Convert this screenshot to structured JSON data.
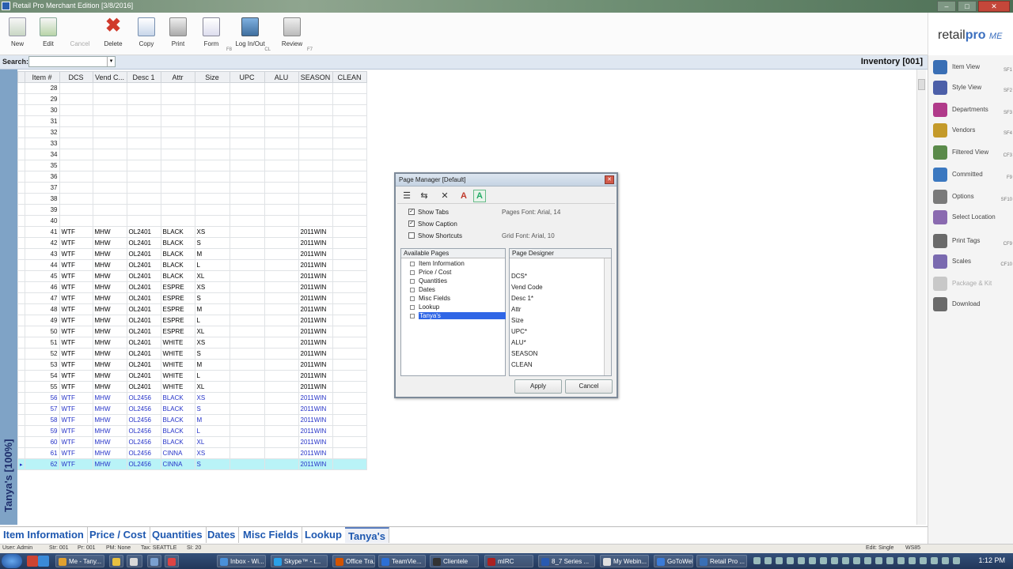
{
  "window": {
    "title": "Retail Pro Merchant Edition [3/8/2016]",
    "buttons": [
      "–",
      "□",
      "✕"
    ]
  },
  "toolbar": [
    {
      "label": "New",
      "icon": "new-doc-icon",
      "hotkey": ""
    },
    {
      "label": "Edit",
      "icon": "edit-icon",
      "hotkey": ""
    },
    {
      "label": "Cancel",
      "icon": "cancel-icon",
      "hotkey": "",
      "disabled": true
    },
    {
      "label": "Delete",
      "icon": "delete-icon",
      "hotkey": ""
    },
    {
      "label": "Copy",
      "icon": "copy-icon",
      "hotkey": ""
    },
    {
      "label": "Print",
      "icon": "print-icon",
      "hotkey": ""
    },
    {
      "label": "Form",
      "icon": "form-icon",
      "hotkey": "F8"
    },
    {
      "label": "Log In/Out",
      "icon": "login-icon",
      "hotkey": "CL"
    },
    {
      "label": "Review",
      "icon": "review-icon",
      "hotkey": "F7"
    }
  ],
  "logo": {
    "main": "retail",
    "pro": "pro",
    "me": "ME"
  },
  "search": {
    "label": "Search:",
    "value": ""
  },
  "module_title": "Inventory [001]",
  "left_label": "Tanya's [100%]",
  "grid": {
    "columns": [
      "Item #",
      "DCS",
      "Vend C...",
      "Desc 1",
      "Attr",
      "Size",
      "UPC",
      "ALU",
      "SEASON",
      "CLEAN"
    ],
    "rows": [
      {
        "n": "28",
        "cells": [
          "",
          "",
          "",
          "",
          "",
          "",
          "",
          "",
          ""
        ]
      },
      {
        "n": "29",
        "cells": [
          "",
          "",
          "",
          "",
          "",
          "",
          "",
          "",
          ""
        ]
      },
      {
        "n": "30",
        "cells": [
          "",
          "",
          "",
          "",
          "",
          "",
          "",
          "",
          ""
        ]
      },
      {
        "n": "31",
        "cells": [
          "",
          "",
          "",
          "",
          "",
          "",
          "",
          "",
          ""
        ]
      },
      {
        "n": "32",
        "cells": [
          "",
          "",
          "",
          "",
          "",
          "",
          "",
          "",
          ""
        ]
      },
      {
        "n": "33",
        "cells": [
          "",
          "",
          "",
          "",
          "",
          "",
          "",
          "",
          ""
        ]
      },
      {
        "n": "34",
        "cells": [
          "",
          "",
          "",
          "",
          "",
          "",
          "",
          "",
          ""
        ]
      },
      {
        "n": "35",
        "cells": [
          "",
          "",
          "",
          "",
          "",
          "",
          "",
          "",
          ""
        ]
      },
      {
        "n": "36",
        "cells": [
          "",
          "",
          "",
          "",
          "",
          "",
          "",
          "",
          ""
        ]
      },
      {
        "n": "37",
        "cells": [
          "",
          "",
          "",
          "",
          "",
          "",
          "",
          "",
          ""
        ]
      },
      {
        "n": "38",
        "cells": [
          "",
          "",
          "",
          "",
          "",
          "",
          "",
          "",
          ""
        ]
      },
      {
        "n": "39",
        "cells": [
          "",
          "",
          "",
          "",
          "",
          "",
          "",
          "",
          ""
        ]
      },
      {
        "n": "40",
        "cells": [
          "",
          "",
          "",
          "",
          "",
          "",
          "",
          "",
          ""
        ]
      },
      {
        "n": "41",
        "cells": [
          "WTF",
          "MHW",
          "OL2401",
          "BLACK",
          "XS",
          "",
          "",
          "2011WIN",
          ""
        ]
      },
      {
        "n": "42",
        "cells": [
          "WTF",
          "MHW",
          "OL2401",
          "BLACK",
          "S",
          "",
          "",
          "2011WIN",
          ""
        ]
      },
      {
        "n": "43",
        "cells": [
          "WTF",
          "MHW",
          "OL2401",
          "BLACK",
          "M",
          "",
          "",
          "2011WIN",
          ""
        ]
      },
      {
        "n": "44",
        "cells": [
          "WTF",
          "MHW",
          "OL2401",
          "BLACK",
          "L",
          "",
          "",
          "2011WIN",
          ""
        ]
      },
      {
        "n": "45",
        "cells": [
          "WTF",
          "MHW",
          "OL2401",
          "BLACK",
          "XL",
          "",
          "",
          "2011WIN",
          ""
        ]
      },
      {
        "n": "46",
        "cells": [
          "WTF",
          "MHW",
          "OL2401",
          "ESPRE",
          "XS",
          "",
          "",
          "2011WIN",
          ""
        ]
      },
      {
        "n": "47",
        "cells": [
          "WTF",
          "MHW",
          "OL2401",
          "ESPRE",
          "S",
          "",
          "",
          "2011WIN",
          ""
        ]
      },
      {
        "n": "48",
        "cells": [
          "WTF",
          "MHW",
          "OL2401",
          "ESPRE",
          "M",
          "",
          "",
          "2011WIN",
          ""
        ]
      },
      {
        "n": "49",
        "cells": [
          "WTF",
          "MHW",
          "OL2401",
          "ESPRE",
          "L",
          "",
          "",
          "2011WIN",
          ""
        ]
      },
      {
        "n": "50",
        "cells": [
          "WTF",
          "MHW",
          "OL2401",
          "ESPRE",
          "XL",
          "",
          "",
          "2011WIN",
          ""
        ]
      },
      {
        "n": "51",
        "cells": [
          "WTF",
          "MHW",
          "OL2401",
          "WHITE",
          "XS",
          "",
          "",
          "2011WIN",
          ""
        ]
      },
      {
        "n": "52",
        "cells": [
          "WTF",
          "MHW",
          "OL2401",
          "WHITE",
          "S",
          "",
          "",
          "2011WIN",
          ""
        ]
      },
      {
        "n": "53",
        "cells": [
          "WTF",
          "MHW",
          "OL2401",
          "WHITE",
          "M",
          "",
          "",
          "2011WIN",
          ""
        ]
      },
      {
        "n": "54",
        "cells": [
          "WTF",
          "MHW",
          "OL2401",
          "WHITE",
          "L",
          "",
          "",
          "2011WIN",
          ""
        ]
      },
      {
        "n": "55",
        "cells": [
          "WTF",
          "MHW",
          "OL2401",
          "WHITE",
          "XL",
          "",
          "",
          "2011WIN",
          ""
        ]
      },
      {
        "n": "56",
        "cells": [
          "WTF",
          "MHW",
          "OL2456",
          "BLACK",
          "XS",
          "",
          "",
          "2011WIN",
          ""
        ],
        "blue": true
      },
      {
        "n": "57",
        "cells": [
          "WTF",
          "MHW",
          "OL2456",
          "BLACK",
          "S",
          "",
          "",
          "2011WIN",
          ""
        ],
        "blue": true
      },
      {
        "n": "58",
        "cells": [
          "WTF",
          "MHW",
          "OL2456",
          "BLACK",
          "M",
          "",
          "",
          "2011WIN",
          ""
        ],
        "blue": true
      },
      {
        "n": "59",
        "cells": [
          "WTF",
          "MHW",
          "OL2456",
          "BLACK",
          "L",
          "",
          "",
          "2011WIN",
          ""
        ],
        "blue": true
      },
      {
        "n": "60",
        "cells": [
          "WTF",
          "MHW",
          "OL2456",
          "BLACK",
          "XL",
          "",
          "",
          "2011WIN",
          ""
        ],
        "blue": true
      },
      {
        "n": "61",
        "cells": [
          "WTF",
          "MHW",
          "OL2456",
          "CINNA",
          "XS",
          "",
          "",
          "2011WIN",
          ""
        ],
        "blue": true
      },
      {
        "n": "62",
        "cells": [
          "WTF",
          "MHW",
          "OL2456",
          "CINNA",
          "S",
          "",
          "",
          "2011WIN",
          ""
        ],
        "blue": true,
        "current": true
      }
    ]
  },
  "side_panel": [
    {
      "label": "Item View",
      "shortcut": "SF1",
      "icon": "item-view-icon",
      "color": "#3a6fb5"
    },
    {
      "label": "Style View",
      "shortcut": "SF2",
      "icon": "style-view-icon",
      "color": "#4c5fa8"
    },
    {
      "label": "Departments",
      "shortcut": "SF3",
      "icon": "departments-icon",
      "color": "#b03a8a"
    },
    {
      "label": "Vendors",
      "shortcut": "SF4",
      "icon": "vendors-icon",
      "color": "#c49a2a"
    },
    {
      "label": "Filtered View",
      "shortcut": "CF3",
      "icon": "filter-icon",
      "color": "#5a8a4a"
    },
    {
      "label": "Committed",
      "shortcut": "F9",
      "icon": "committed-icon",
      "color": "#3b78c0"
    },
    {
      "label": "Options",
      "shortcut": "SF10",
      "icon": "options-icon",
      "color": "#7a7a7a"
    },
    {
      "label": "Select Location",
      "shortcut": "",
      "icon": "location-icon",
      "color": "#8a6ab0"
    },
    {
      "label": "Print Tags",
      "shortcut": "CF9",
      "icon": "print-tags-icon",
      "color": "#6a6a6a"
    },
    {
      "label": "Scales",
      "shortcut": "CF10",
      "icon": "scales-icon",
      "color": "#7a6ab0"
    },
    {
      "label": "Package & Kit",
      "shortcut": "",
      "icon": "package-icon",
      "color": "#c8c8c8",
      "disabled": true
    },
    {
      "label": "Download",
      "shortcut": "",
      "icon": "download-icon",
      "color": "#6a6a6a"
    }
  ],
  "tabs": [
    "Item Information",
    "Price / Cost",
    "Quantities",
    "Dates",
    "Misc Fields",
    "Lookup",
    "Tanya's"
  ],
  "active_tab": "Tanya's",
  "status": {
    "user": "User: Admin",
    "store": "Str: 001",
    "printer": "Pr: 001",
    "pm": "PM: None",
    "tax": "Tax: SEATTLE",
    "si": "SI: 20",
    "mode": "Edit: Single",
    "ws": "WS85"
  },
  "dialog": {
    "title": "Page Manager [Default]",
    "close": "✕",
    "options": [
      {
        "label": "Show Tabs",
        "checked": true
      },
      {
        "label": "Show Caption",
        "checked": true
      },
      {
        "label": "Show Shortcuts",
        "checked": false
      }
    ],
    "pages_font": "Pages Font: Arial, 14",
    "grid_font": "Grid Font: Arial, 10",
    "available_header": "Available Pages",
    "available_pages": [
      "Item Information",
      "Price / Cost",
      "Quantities",
      "Dates",
      "Misc Fields",
      "Lookup",
      "Tanya's"
    ],
    "selected_page": "Tanya's",
    "designer_header": "Page Designer",
    "designer_fields": [
      "DCS*",
      "Vend Code",
      "Desc 1*",
      "Attr",
      "Size",
      "UPC*",
      "ALU*",
      "SEASON",
      "CLEAN"
    ],
    "apply": "Apply",
    "cancel": "Cancel"
  },
  "taskbar": {
    "items": [
      "Me - Tany...",
      "",
      "",
      "",
      "",
      "Inbox - Wi...",
      "Skype™ - t...",
      "Office Tra...",
      "TeamVie...",
      "Clientele",
      "mIRC",
      "8_7 Series ...",
      "My Webin...",
      "GoToWeb...",
      "Retail Pro ..."
    ],
    "time": "1:12 PM"
  }
}
